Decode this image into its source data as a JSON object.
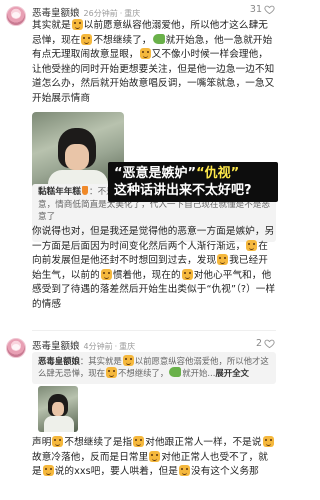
{
  "colors": {
    "caption_bg": "#0d0d0d",
    "caption_highlight": "#ffe94a",
    "quote_bg": "#f3f3f3",
    "meta_gray": "#9b9b9b"
  },
  "comment1": {
    "username": "恶毒皇额娘",
    "time": "26分钟前",
    "location": "重庆",
    "likes": "31",
    "text_p1": "其实就是",
    "text_p2": "以前愿意纵容他溺爱他，所以他才这么肆无忌惮，现在",
    "text_p3": "不想继续了，",
    "text_p4": "就开始急，他一急就开始有点无理取闹故意显眼，",
    "text_p5": "又不像小时候一样会理他，让他受挫的同时开始更想要关注，但是他一边急一边不知道怎么办，然后就开始故意唱反调，一嘴笨就急，一急又开始展示情商",
    "caption_l1a": "“恶意是嫉妒”",
    "caption_l1b": "“仇视”",
    "caption_l2": "这种话讲出来不太好吧?",
    "quote_name": "黏糕年年糕",
    "quote_sep": "：",
    "quote_text": "不是无理取闹和情商低，是怪总和赤裸裸的恶意，情商低简直是太美化了，代入一下自己现在就懂是不是恶意了",
    "reply_p1": "你说得也对，但是我还是觉得他的恶意一方面是嫉妒，另一方面是后面因为时间变化然后两个人渐行渐远，",
    "reply_p2": "在向前发展但是他还封不时想回到过去，发现",
    "reply_p3": "我已经开始生气，以前的",
    "reply_p4": "惯着他，现在的",
    "reply_p5": "对他心平气和，他感受到了待遇的落差然后开始生出类似于“仇视”（?）一样的情感"
  },
  "comment2": {
    "username": "恶毒皇额娘",
    "time": "4分钟前",
    "location": "重庆",
    "likes": "2",
    "quote_name": "恶毒皇额娘",
    "quote_sep": "：",
    "quote_text_a": "其实就是",
    "quote_text_b": "以前愿意纵容他溺爱他，所以他才这么肆无忌惮，现在",
    "quote_text_c": "不想继续了，",
    "quote_text_d": "就开始...",
    "expand_label": "展开全文",
    "text_p1": "声明",
    "text_p2": "不想继续了是指",
    "text_p3": "对他跟正常人一样，不是说",
    "text_p4": "故意冷落他，反而是日常里",
    "text_p5": "对他正常人也受不了，就是",
    "text_p6": "说的xxs吧，要人哄着，但是",
    "text_p7": "没有这个义务那"
  }
}
